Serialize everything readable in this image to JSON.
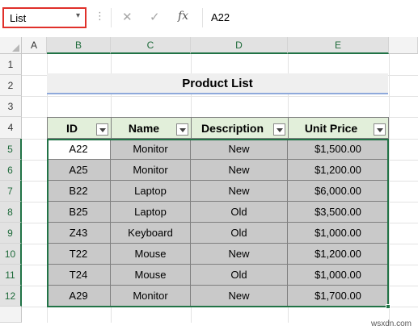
{
  "name_box": {
    "value": "List"
  },
  "formula_bar": {
    "value": "A22"
  },
  "columns": [
    "A",
    "B",
    "C",
    "D",
    "E"
  ],
  "rows": [
    "1",
    "2",
    "3",
    "4",
    "5",
    "6",
    "7",
    "8",
    "9",
    "10",
    "11",
    "12"
  ],
  "table": {
    "title": "Product List",
    "headers": [
      "ID",
      "Name",
      "Description",
      "Unit Price"
    ],
    "rows": [
      [
        "A22",
        "Monitor",
        "New",
        "$1,500.00"
      ],
      [
        "A25",
        "Monitor",
        "New",
        "$1,200.00"
      ],
      [
        "B22",
        "Laptop",
        "New",
        "$6,000.00"
      ],
      [
        "B25",
        "Laptop",
        "Old",
        "$3,500.00"
      ],
      [
        "Z43",
        "Keyboard",
        "Old",
        "$1,000.00"
      ],
      [
        "T22",
        "Mouse",
        "New",
        "$1,200.00"
      ],
      [
        "T24",
        "Mouse",
        "Old",
        "$1,000.00"
      ],
      [
        "A29",
        "Monitor",
        "New",
        "$1,700.00"
      ]
    ]
  },
  "icons": {
    "cancel": "✕",
    "confirm": "✓",
    "function": "fx",
    "dropdown": "▾",
    "more": "⋮"
  },
  "colors": {
    "name_box_border": "#e0302a",
    "selection": "#217346",
    "header_fill": "#e2efda",
    "data_fill": "#c9c9c9"
  },
  "watermark": "wsxdn.com"
}
